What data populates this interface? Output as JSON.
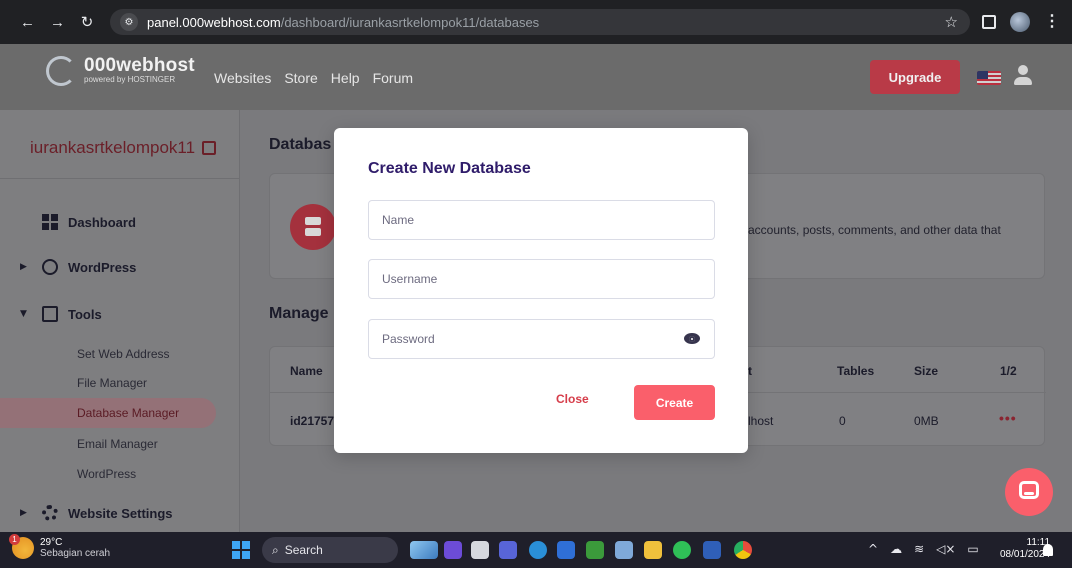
{
  "browser": {
    "url_host": "panel.000webhost.com",
    "url_path": "/dashboard/iurankasrtkelompok11/databases"
  },
  "header": {
    "brand": "000webhost",
    "brand_sub": "powered by HOSTINGER",
    "nav": [
      "Websites",
      "Store",
      "Help",
      "Forum"
    ],
    "upgrade_label": "Upgrade"
  },
  "sidebar": {
    "site_name": "iurankasrtkelompok11",
    "items": [
      {
        "label": "Dashboard"
      },
      {
        "label": "WordPress"
      },
      {
        "label": "Tools"
      }
    ],
    "tools_subitems": [
      "Set Web Address",
      "File Manager",
      "Database Manager",
      "Email Manager",
      "WordPress"
    ],
    "active_subitem": "Database Manager",
    "settings_label": "Website Settings"
  },
  "main": {
    "title_partial": "Databas",
    "info_text_partial": "accounts, posts, comments, and other data that",
    "manage_title_partial": "Manage",
    "table": {
      "headers": {
        "name": "Name",
        "host_partial": "t",
        "tables": "Tables",
        "size": "Size",
        "pages": "1/2"
      },
      "row": {
        "name_partial": "id217574",
        "host_partial": "lhost",
        "tables": "0",
        "size": "0MB",
        "menu": "•••"
      }
    }
  },
  "modal": {
    "title": "Create New Database",
    "name_placeholder": "Name",
    "username_placeholder": "Username",
    "password_placeholder": "Password",
    "close_label": "Close",
    "create_label": "Create"
  },
  "taskbar": {
    "temperature": "29°C",
    "weather": "Sebagian cerah",
    "weather_badge": "1",
    "search_label": "Search",
    "time": "11:11",
    "date": "08/01/2024"
  },
  "colors": {
    "accent": "#fa5f6b",
    "modal_title": "#2f1c6a",
    "upgrade_dimmed": "#b93a47"
  }
}
